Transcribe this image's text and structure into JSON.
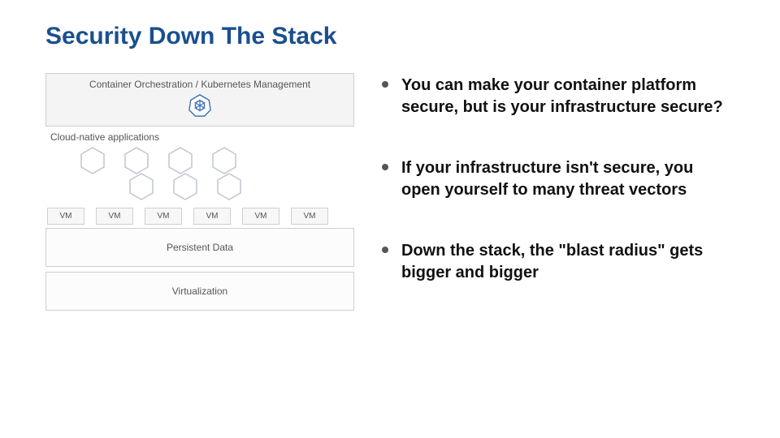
{
  "title": "Security Down The Stack",
  "diagram": {
    "orchestration_label": "Container Orchestration / Kubernetes Management",
    "cloud_native_label": "Cloud-native applications",
    "vm_label": "VM",
    "persistent_label": "Persistent Data",
    "virtualization_label": "Virtualization"
  },
  "bullets": [
    "You can make your container platform secure, but is your infrastructure secure?",
    "If your infrastructure isn't secure, you open yourself to many threat vectors",
    "Down the stack, the \"blast radius\" gets bigger and bigger"
  ],
  "colors": {
    "title": "#1b4f8f",
    "hex_stroke": "#bfc6cf",
    "wheel": "#3a6fb7"
  }
}
